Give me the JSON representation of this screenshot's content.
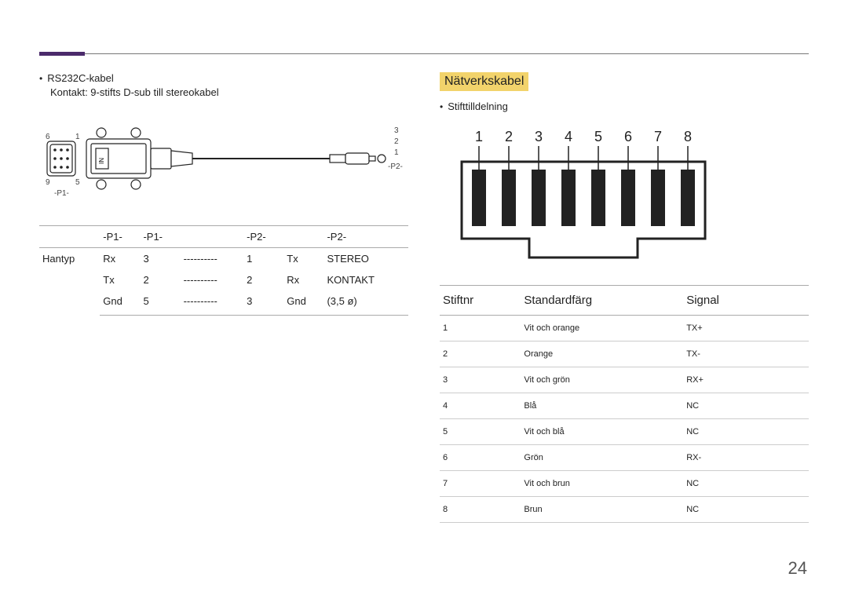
{
  "page_number": "24",
  "left": {
    "cable_name": "RS232C-kabel",
    "connector_desc": "Kontakt: 9-stifts D-sub till stereokabel",
    "diagram": {
      "pin6": "6",
      "pin1": "1",
      "pin9": "9",
      "pin5": "5",
      "p1_label": "-P1-",
      "p2_label": "-P2-",
      "p2_pin3": "3",
      "p2_pin2": "2",
      "p2_pin1": "1",
      "in_text": "IN"
    },
    "table_headers": [
      "-P1-",
      "-P1-",
      "",
      "-P2-",
      "",
      "-P2-"
    ],
    "rowlabel": "Hantyp",
    "rows": [
      [
        "Rx",
        "3",
        "----------",
        "1",
        "Tx",
        "STEREO"
      ],
      [
        "Tx",
        "2",
        "----------",
        "2",
        "Rx",
        "KONTAKT"
      ],
      [
        "Gnd",
        "5",
        "----------",
        "3",
        "Gnd",
        "(3,5 ø)"
      ]
    ]
  },
  "right": {
    "title": "Nätverkskabel",
    "pin_assignment": "Stifttilldelning",
    "pin_numbers": [
      "1",
      "2",
      "3",
      "4",
      "5",
      "6",
      "7",
      "8"
    ],
    "table_headers": [
      "Stiftnr",
      "Standardfärg",
      "Signal"
    ],
    "rows": [
      [
        "1",
        "Vit och orange",
        "TX+"
      ],
      [
        "2",
        "Orange",
        "TX-"
      ],
      [
        "3",
        "Vit och grön",
        "RX+"
      ],
      [
        "4",
        "Blå",
        "NC"
      ],
      [
        "5",
        "Vit och blå",
        "NC"
      ],
      [
        "6",
        "Grön",
        "RX-"
      ],
      [
        "7",
        "Vit och brun",
        "NC"
      ],
      [
        "8",
        "Brun",
        "NC"
      ]
    ]
  }
}
